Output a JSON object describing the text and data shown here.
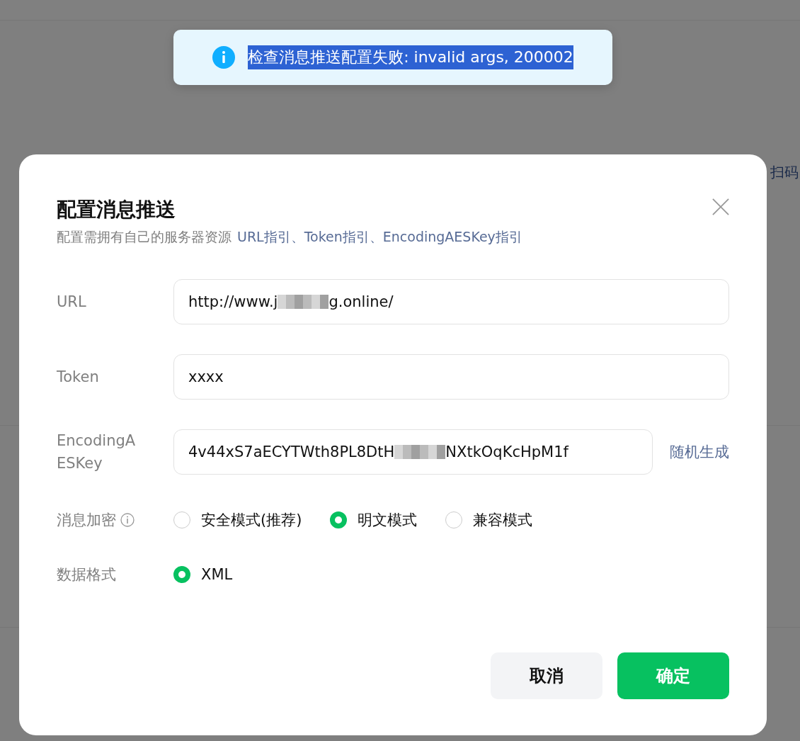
{
  "background": {
    "texts": [
      "扫码"
    ]
  },
  "toast": {
    "message": "检查消息推送配置失败: invalid args, 200002",
    "text_selected": true
  },
  "dialog": {
    "title": "配置消息推送",
    "subtitle": "配置需拥有自己的服务器资源",
    "links": [
      "URL指引",
      "Token指引",
      "EncodingAESKey指引"
    ],
    "link_separator": "、",
    "fields": [
      {
        "label": "URL",
        "value_start": "http://www.j",
        "value_end": "g.online/",
        "redacted": true
      },
      {
        "label": "Token",
        "value_start": "xxxx",
        "redacted": false
      },
      {
        "label": "EncodingAESKey",
        "value_start": "4v44xS7aECYTWth8PL8DtH",
        "value_end": "NXtkOqKcHpM1f",
        "redacted": true,
        "action": "随机生成"
      }
    ],
    "radio_groups": [
      {
        "label": "消息加密",
        "info": true,
        "options": [
          {
            "label": "安全模式(推荐)",
            "selected": false
          },
          {
            "label": "明文模式",
            "selected": true
          },
          {
            "label": "兼容模式",
            "selected": false
          }
        ]
      },
      {
        "label": "数据格式",
        "info": false,
        "options": [
          {
            "label": "XML",
            "selected": true
          }
        ]
      }
    ],
    "buttons": [
      {
        "label": "取消",
        "kind": "secondary"
      },
      {
        "label": "确定",
        "kind": "primary"
      }
    ]
  }
}
